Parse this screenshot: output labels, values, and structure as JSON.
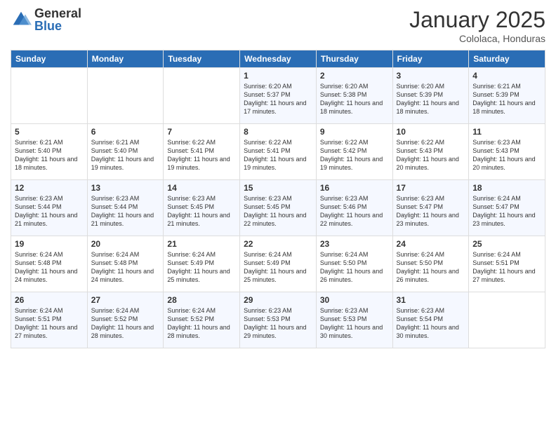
{
  "header": {
    "logo_general": "General",
    "logo_blue": "Blue",
    "month_title": "January 2025",
    "subtitle": "Cololaca, Honduras"
  },
  "weekdays": [
    "Sunday",
    "Monday",
    "Tuesday",
    "Wednesday",
    "Thursday",
    "Friday",
    "Saturday"
  ],
  "weeks": [
    [
      {
        "day": "",
        "sunrise": "",
        "sunset": "",
        "daylight": ""
      },
      {
        "day": "",
        "sunrise": "",
        "sunset": "",
        "daylight": ""
      },
      {
        "day": "",
        "sunrise": "",
        "sunset": "",
        "daylight": ""
      },
      {
        "day": "1",
        "sunrise": "6:20 AM",
        "sunset": "5:37 PM",
        "daylight": "11 hours and 17 minutes."
      },
      {
        "day": "2",
        "sunrise": "6:20 AM",
        "sunset": "5:38 PM",
        "daylight": "11 hours and 18 minutes."
      },
      {
        "day": "3",
        "sunrise": "6:20 AM",
        "sunset": "5:39 PM",
        "daylight": "11 hours and 18 minutes."
      },
      {
        "day": "4",
        "sunrise": "6:21 AM",
        "sunset": "5:39 PM",
        "daylight": "11 hours and 18 minutes."
      }
    ],
    [
      {
        "day": "5",
        "sunrise": "6:21 AM",
        "sunset": "5:40 PM",
        "daylight": "11 hours and 18 minutes."
      },
      {
        "day": "6",
        "sunrise": "6:21 AM",
        "sunset": "5:40 PM",
        "daylight": "11 hours and 19 minutes."
      },
      {
        "day": "7",
        "sunrise": "6:22 AM",
        "sunset": "5:41 PM",
        "daylight": "11 hours and 19 minutes."
      },
      {
        "day": "8",
        "sunrise": "6:22 AM",
        "sunset": "5:41 PM",
        "daylight": "11 hours and 19 minutes."
      },
      {
        "day": "9",
        "sunrise": "6:22 AM",
        "sunset": "5:42 PM",
        "daylight": "11 hours and 19 minutes."
      },
      {
        "day": "10",
        "sunrise": "6:22 AM",
        "sunset": "5:43 PM",
        "daylight": "11 hours and 20 minutes."
      },
      {
        "day": "11",
        "sunrise": "6:23 AM",
        "sunset": "5:43 PM",
        "daylight": "11 hours and 20 minutes."
      }
    ],
    [
      {
        "day": "12",
        "sunrise": "6:23 AM",
        "sunset": "5:44 PM",
        "daylight": "11 hours and 21 minutes."
      },
      {
        "day": "13",
        "sunrise": "6:23 AM",
        "sunset": "5:44 PM",
        "daylight": "11 hours and 21 minutes."
      },
      {
        "day": "14",
        "sunrise": "6:23 AM",
        "sunset": "5:45 PM",
        "daylight": "11 hours and 21 minutes."
      },
      {
        "day": "15",
        "sunrise": "6:23 AM",
        "sunset": "5:45 PM",
        "daylight": "11 hours and 22 minutes."
      },
      {
        "day": "16",
        "sunrise": "6:23 AM",
        "sunset": "5:46 PM",
        "daylight": "11 hours and 22 minutes."
      },
      {
        "day": "17",
        "sunrise": "6:23 AM",
        "sunset": "5:47 PM",
        "daylight": "11 hours and 23 minutes."
      },
      {
        "day": "18",
        "sunrise": "6:24 AM",
        "sunset": "5:47 PM",
        "daylight": "11 hours and 23 minutes."
      }
    ],
    [
      {
        "day": "19",
        "sunrise": "6:24 AM",
        "sunset": "5:48 PM",
        "daylight": "11 hours and 24 minutes."
      },
      {
        "day": "20",
        "sunrise": "6:24 AM",
        "sunset": "5:48 PM",
        "daylight": "11 hours and 24 minutes."
      },
      {
        "day": "21",
        "sunrise": "6:24 AM",
        "sunset": "5:49 PM",
        "daylight": "11 hours and 25 minutes."
      },
      {
        "day": "22",
        "sunrise": "6:24 AM",
        "sunset": "5:49 PM",
        "daylight": "11 hours and 25 minutes."
      },
      {
        "day": "23",
        "sunrise": "6:24 AM",
        "sunset": "5:50 PM",
        "daylight": "11 hours and 26 minutes."
      },
      {
        "day": "24",
        "sunrise": "6:24 AM",
        "sunset": "5:50 PM",
        "daylight": "11 hours and 26 minutes."
      },
      {
        "day": "25",
        "sunrise": "6:24 AM",
        "sunset": "5:51 PM",
        "daylight": "11 hours and 27 minutes."
      }
    ],
    [
      {
        "day": "26",
        "sunrise": "6:24 AM",
        "sunset": "5:51 PM",
        "daylight": "11 hours and 27 minutes."
      },
      {
        "day": "27",
        "sunrise": "6:24 AM",
        "sunset": "5:52 PM",
        "daylight": "11 hours and 28 minutes."
      },
      {
        "day": "28",
        "sunrise": "6:24 AM",
        "sunset": "5:52 PM",
        "daylight": "11 hours and 28 minutes."
      },
      {
        "day": "29",
        "sunrise": "6:23 AM",
        "sunset": "5:53 PM",
        "daylight": "11 hours and 29 minutes."
      },
      {
        "day": "30",
        "sunrise": "6:23 AM",
        "sunset": "5:53 PM",
        "daylight": "11 hours and 30 minutes."
      },
      {
        "day": "31",
        "sunrise": "6:23 AM",
        "sunset": "5:54 PM",
        "daylight": "11 hours and 30 minutes."
      },
      {
        "day": "",
        "sunrise": "",
        "sunset": "",
        "daylight": ""
      }
    ]
  ],
  "labels": {
    "sunrise_prefix": "Sunrise: ",
    "sunset_prefix": "Sunset: ",
    "daylight_prefix": "Daylight: "
  }
}
